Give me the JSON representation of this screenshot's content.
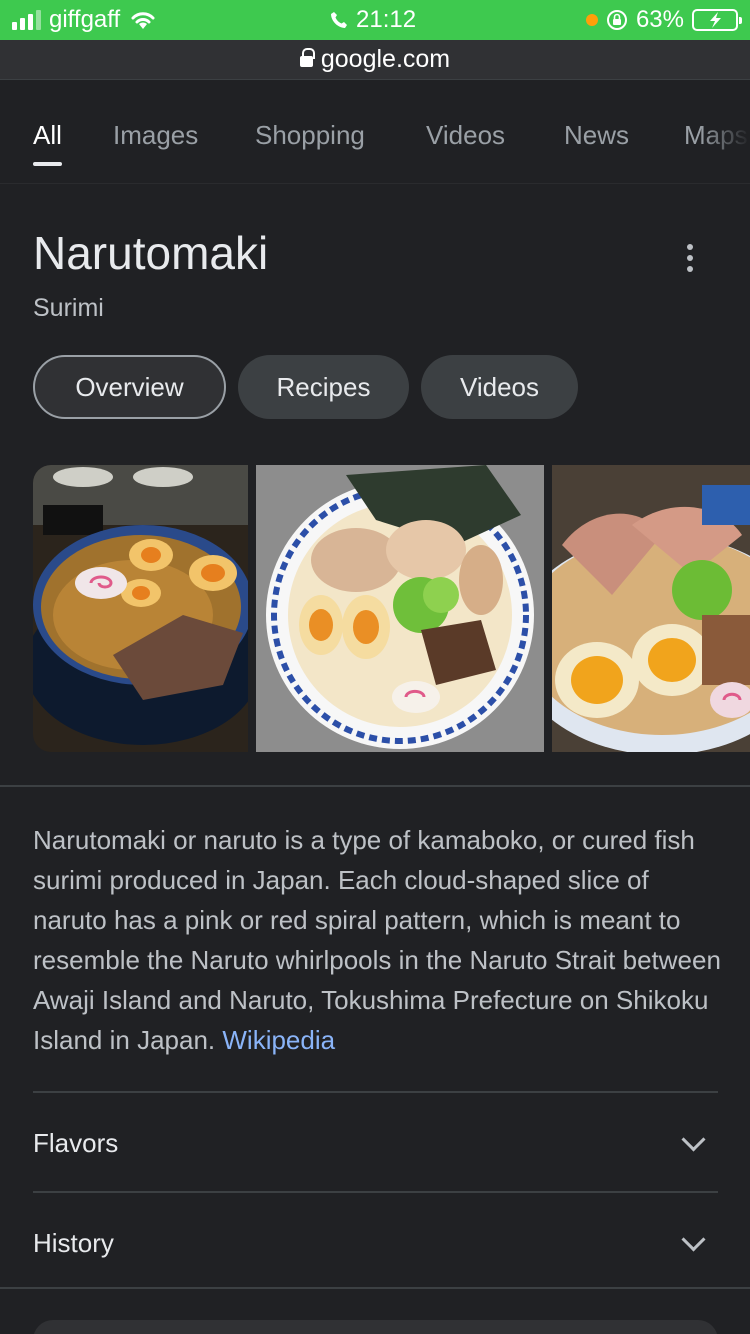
{
  "status_bar": {
    "carrier": "giffgaff",
    "time": "21:12",
    "battery": "63%"
  },
  "url_bar": {
    "domain": "google.com"
  },
  "tabs": [
    {
      "label": "All",
      "active": true
    },
    {
      "label": "Images",
      "active": false
    },
    {
      "label": "Shopping",
      "active": false
    },
    {
      "label": "Videos",
      "active": false
    },
    {
      "label": "News",
      "active": false
    },
    {
      "label": "Maps",
      "active": false
    }
  ],
  "entity": {
    "title": "Narutomaki",
    "subtitle": "Surimi"
  },
  "chips": [
    {
      "label": "Overview",
      "selected": true
    },
    {
      "label": "Recipes",
      "selected": false
    },
    {
      "label": "Videos",
      "selected": false
    }
  ],
  "description": {
    "text": "Narutomaki or naruto is a type of kamaboko, or cured fish surimi produced in Japan. Each cloud-shaped slice of naruto has a pink or red spiral pattern, which is meant to resemble the Naruto whirlpools in the Naruto Strait between Awaji Island and Naruto, Tokushima Prefecture on Shikoku Island in Japan.",
    "source": "Wikipedia"
  },
  "sections": [
    {
      "label": "Flavors"
    },
    {
      "label": "History"
    }
  ],
  "colors": {
    "background": "#202124",
    "status_bar": "#3ec94f",
    "link": "#8ab4f8"
  },
  "icons": {
    "more": "more-vert-icon",
    "expand": "chevron-down-icon",
    "lock": "lock-icon"
  }
}
